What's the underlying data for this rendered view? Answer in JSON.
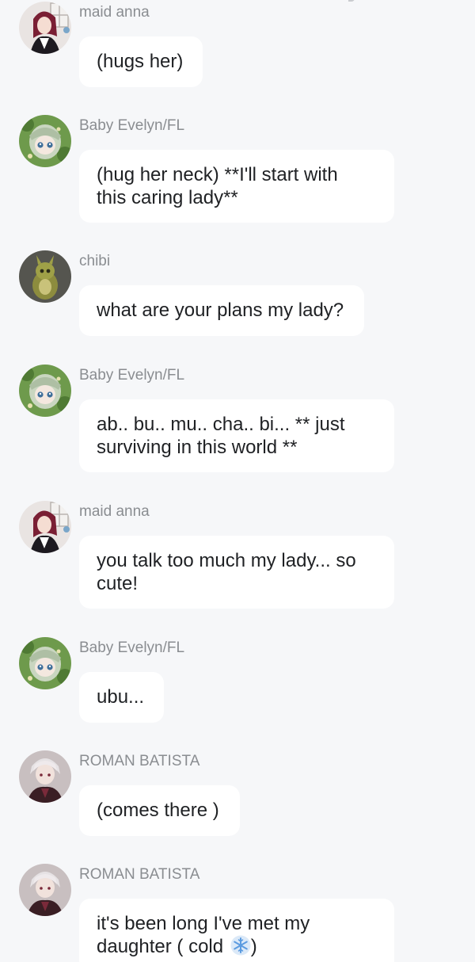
{
  "messages": [
    {
      "sender": "maid anna",
      "avatar": "maid-anna-avatar",
      "text": "(hugs her)"
    },
    {
      "sender": "Baby Evelyn/FL",
      "avatar": "baby-evelyn-avatar",
      "text": "(hug her neck) **I'll start with\nthis caring lady**"
    },
    {
      "sender": "chibi",
      "avatar": "chibi-avatar",
      "text": "what are your plans my lady?"
    },
    {
      "sender": "Baby Evelyn/FL",
      "avatar": "baby-evelyn-avatar",
      "text": "ab.. bu.. mu.. cha.. bi... ** just\nsurviving in this world **"
    },
    {
      "sender": "maid anna",
      "avatar": "maid-anna-avatar",
      "text": "you talk too much my lady... so\ncute!"
    },
    {
      "sender": "Baby Evelyn/FL",
      "avatar": "baby-evelyn-avatar",
      "text": "ubu..."
    },
    {
      "sender": "ROMAN BATISTA",
      "avatar": "roman-batista-avatar",
      "text": "(comes there )"
    },
    {
      "sender": "ROMAN BATISTA",
      "avatar": "roman-batista-avatar",
      "text": "it's been long I've met my\ndaughter ( cold ",
      "suffix": ")",
      "emoji": "snowflake-icon"
    }
  ]
}
